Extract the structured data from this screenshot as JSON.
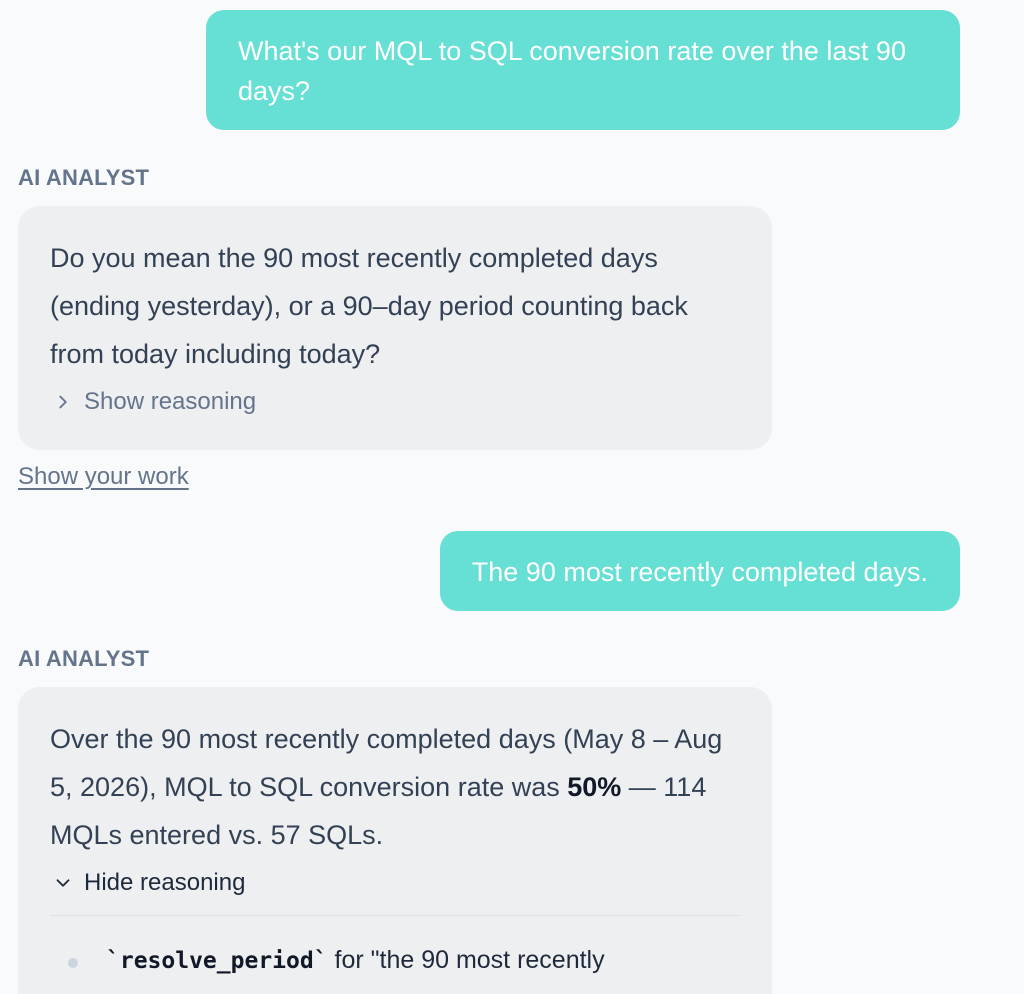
{
  "messages": {
    "user_1": "What's our MQL to SQL conversion rate over the last 90 days?",
    "ai_label_1": "AI ANALYST",
    "ai_1_text": "Do you mean the 90 most recently completed days (ending yesterday), or a 90–day period counting back from today including today?",
    "ai_1_toggle": "Show reasoning",
    "show_work": "Show your work",
    "user_2": "The 90 most recently completed days.",
    "ai_label_2": "AI ANALYST",
    "ai_2_text_before": "Over the 90 most recently completed days (May 8 – Aug 5, 2026), MQL to SQL conversion rate was ",
    "ai_2_bold": "50%",
    "ai_2_text_after": " — 114 MQLs entered vs. 57 SQLs.",
    "ai_2_toggle": "Hide reasoning",
    "reason_code": "`resolve_period`",
    "reason_text": " for \"the 90 most recently"
  },
  "icons": {
    "collapsed": "chevron-right-icon",
    "expanded": "chevron-down-icon"
  },
  "colors": {
    "user_bubble": "#66dfd4",
    "ai_bubble": "#eeeff1",
    "background": "#f8fafc"
  }
}
